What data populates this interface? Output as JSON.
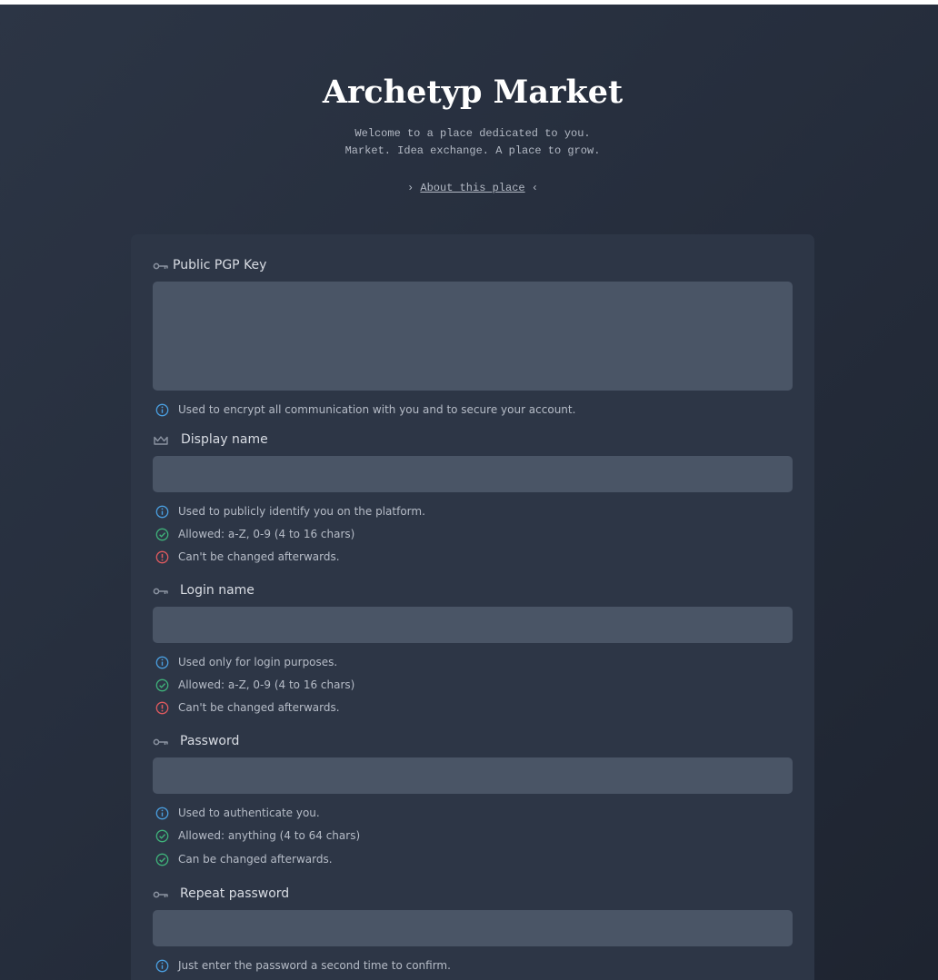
{
  "site": {
    "title": "Archetyp Market",
    "tagline_1": "Welcome to a place dedicated to you.",
    "tagline_2": "Market. Idea exchange. A place to grow.",
    "about_prefix": "›",
    "about_link": "About this place",
    "about_suffix": "‹"
  },
  "colors": {
    "info": "#4a9fe0",
    "ok": "#3fb27a",
    "warn": "#e05a5f",
    "field_bg": "#4a5566",
    "card_bg": "#2d3646"
  },
  "form": {
    "pgp": {
      "icon": "key-icon",
      "label": "Public PGP Key",
      "value": "",
      "hints": [
        {
          "type": "info",
          "icon": "info-icon",
          "text": "Used to encrypt all communication with you and to secure your account."
        }
      ]
    },
    "display_name": {
      "icon": "crown-icon",
      "label": "Display name",
      "value": "",
      "hints": [
        {
          "type": "info",
          "icon": "info-icon",
          "text": "Used to publicly identify you on the platform."
        },
        {
          "type": "ok",
          "icon": "check-circle-icon",
          "text": "Allowed: a-Z, 0-9 (4 to 16 chars)"
        },
        {
          "type": "warn",
          "icon": "alert-circle-icon",
          "text": "Can't be changed afterwards."
        }
      ]
    },
    "login_name": {
      "icon": "key-icon",
      "label": "Login name",
      "value": "",
      "hints": [
        {
          "type": "info",
          "icon": "info-icon",
          "text": "Used only for login purposes."
        },
        {
          "type": "ok",
          "icon": "check-circle-icon",
          "text": "Allowed: a-Z, 0-9 (4 to 16 chars)"
        },
        {
          "type": "warn",
          "icon": "alert-circle-icon",
          "text": "Can't be changed afterwards."
        }
      ]
    },
    "password": {
      "icon": "key-icon",
      "label": "Password",
      "value": "",
      "hints": [
        {
          "type": "info",
          "icon": "info-icon",
          "text": "Used to authenticate you."
        },
        {
          "type": "ok",
          "icon": "check-circle-icon",
          "text": "Allowed: anything (4 to 64 chars)"
        },
        {
          "type": "ok",
          "icon": "check-circle-icon",
          "text": "Can be changed afterwards."
        }
      ]
    },
    "repeat_password": {
      "icon": "key-icon",
      "label": "Repeat password",
      "value": "",
      "hints": [
        {
          "type": "info",
          "icon": "info-icon",
          "text": "Just enter the password a second time to confirm."
        }
      ]
    }
  }
}
